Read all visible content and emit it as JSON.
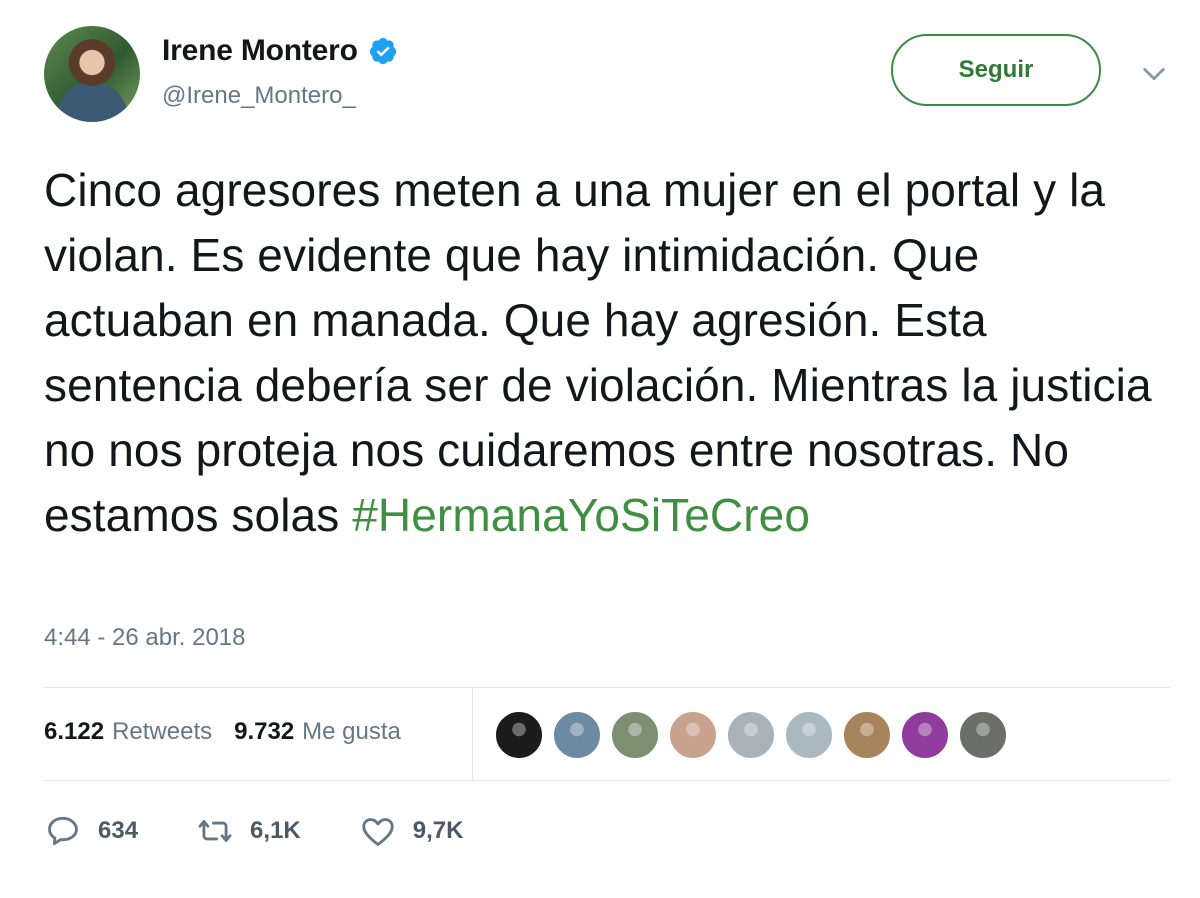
{
  "author": {
    "name": "Irene Montero",
    "handle": "@Irene_Montero_",
    "verified_icon": "verified-badge-icon",
    "avatar_icon": "profile-photo"
  },
  "follow_button": {
    "label": "Seguir"
  },
  "menu": {
    "icon": "chevron-down-icon"
  },
  "tweet": {
    "text": "Cinco agresores meten a una mujer en el portal y la violan. Es evidente que hay intimidación. Que actuaban en manada. Que hay agresión. Esta sentencia debería ser de violación. Mientras la justicia no nos proteja nos cuidaremos entre nosotras. No estamos solas",
    "hashtag": "#HermanaYoSiTeCreo",
    "timestamp": "4:44 - 26 abr. 2018"
  },
  "stats": {
    "retweets_count": "6.122",
    "retweets_label": "Retweets",
    "likes_count": "9.732",
    "likes_label": "Me gusta"
  },
  "likers": [
    {
      "name": "liker-avatar-1",
      "color": "#1c1c1c"
    },
    {
      "name": "liker-avatar-2",
      "color": "#6d8aa3"
    },
    {
      "name": "liker-avatar-3",
      "color": "#7c8f70"
    },
    {
      "name": "liker-avatar-4",
      "color": "#c9a28d"
    },
    {
      "name": "liker-avatar-5",
      "color": "#a9b2b8"
    },
    {
      "name": "liker-avatar-6",
      "color": "#aab8c2"
    },
    {
      "name": "liker-avatar-7",
      "color": "#a8845c"
    },
    {
      "name": "liker-avatar-8",
      "color": "#8f3c9e"
    },
    {
      "name": "liker-avatar-9",
      "color": "#6c6e68"
    }
  ],
  "actions": {
    "replies": "634",
    "retweets": "6,1K",
    "likes": "9,7K"
  },
  "colors": {
    "accent": "#3f8f42",
    "text": "#14171a",
    "muted": "#657786",
    "verified": "#1da1f2"
  }
}
